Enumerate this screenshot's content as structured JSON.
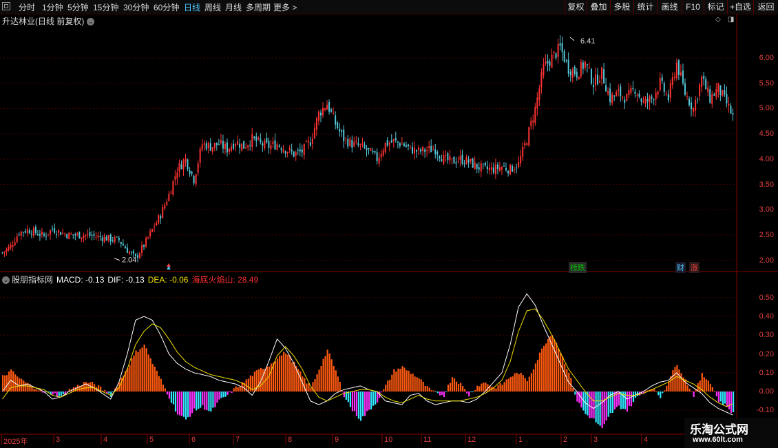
{
  "toolbar": {
    "periods": [
      "分时",
      "1分钟",
      "5分钟",
      "15分钟",
      "30分钟",
      "60分钟",
      "日线",
      "周线",
      "月线",
      "多周期",
      "更多 >"
    ],
    "active_period": "日线",
    "right_buttons": [
      "复权",
      "叠加",
      "多股",
      "统计",
      "画线",
      "F10",
      "标记",
      "+自选",
      "返回"
    ]
  },
  "price_panel": {
    "title": "升达林业(日线 前复权)",
    "high_label": "6.41",
    "low_label": "2.04",
    "axis_ticks": [
      "6.00",
      "5.50",
      "5.00",
      "4.50",
      "4.00",
      "3.50",
      "3.00",
      "2.50",
      "2.00"
    ],
    "tags": [
      {
        "text": "榜跌",
        "color": "#00c000",
        "bg": "#2a2a2a"
      },
      {
        "text": "财",
        "color": "#4fc3f7",
        "bg": "#1a1a2a"
      },
      {
        "text": "涨",
        "color": "#ff4040",
        "bg": "#2a1a1a"
      }
    ]
  },
  "indicator_panel": {
    "name": "股朋指标网",
    "macd_label": "MACD: -0.13",
    "dif_label": "DIF: -0.13",
    "dea_label": "DEA: -0.06",
    "extra_label": "海底火焰山: 28.49",
    "axis_ticks": [
      "0.50",
      "0.40",
      "0.30",
      "0.20",
      "0.10",
      "0.00",
      "-0.10"
    ]
  },
  "date_axis": [
    "2025年",
    "3",
    "4",
    "5",
    "6",
    "7",
    "8",
    "9",
    "10",
    "11",
    "12",
    "1",
    "2",
    "3",
    "4"
  ],
  "watermark": {
    "line1": "乐淘公式网",
    "line2": "www.60lt.com"
  },
  "colors": {
    "up": "#ff3232",
    "down": "#54c8d8",
    "grid": "#4a0000",
    "dif": "#ffffff",
    "dea": "#f0e000",
    "hist_pos": "#ff5a10",
    "hist_neg_a": "#30e8ff",
    "hist_neg_b": "#ff30ff"
  },
  "chart_data": [
    {
      "type": "candlestick",
      "title": "升达林业(日线 前复权)",
      "ylim": [
        1.9,
        6.6
      ],
      "series": [
        {
          "name": "close",
          "values": [
            2.15,
            2.28,
            2.55,
            2.6,
            2.55,
            2.48,
            2.62,
            2.55,
            2.5,
            2.5,
            2.5,
            2.48,
            2.45,
            2.42,
            2.4,
            2.2,
            2.04,
            2.3,
            2.6,
            2.9,
            3.3,
            3.8,
            4.0,
            3.6,
            4.3,
            4.25,
            4.3,
            4.2,
            4.35,
            4.25,
            4.4,
            4.3,
            4.25,
            4.3,
            4.2,
            4.1,
            4.15,
            4.35,
            4.9,
            5.1,
            4.7,
            4.4,
            4.3,
            4.25,
            4.15,
            4.0,
            4.3,
            4.35,
            4.3,
            4.2,
            4.15,
            4.18,
            4.2,
            4.0,
            3.95,
            4.0,
            3.95,
            3.85,
            3.8,
            3.8,
            3.85,
            3.8,
            3.9,
            4.4,
            5.0,
            5.8,
            6.0,
            6.2,
            5.8,
            5.7,
            5.9,
            5.5,
            5.7,
            5.2,
            5.3,
            5.2,
            5.4,
            5.1,
            5.2,
            5.5,
            5.2,
            5.9,
            5.3,
            5.0,
            5.6,
            5.2,
            5.4,
            5.1,
            4.75
          ]
        }
      ]
    },
    {
      "type": "bar",
      "title": "MACD",
      "ylim": [
        -0.22,
        0.58
      ],
      "series": [
        {
          "name": "MACD",
          "values": [
            0.08,
            0.11,
            0.07,
            0.04,
            0.02,
            -0.01,
            -0.01,
            -0.03,
            0.01,
            0.03,
            0.05,
            0.04,
            0.01,
            -0.02,
            0.05,
            0.13,
            0.21,
            0.25,
            0.15,
            0.06,
            -0.03,
            -0.12,
            -0.15,
            -0.1,
            -0.08,
            -0.11,
            -0.05,
            -0.02,
            0.02,
            0.05,
            0.09,
            0.12,
            0.14,
            0.18,
            0.21,
            0.15,
            0.08,
            0.02,
            0.12,
            0.22,
            0.11,
            -0.02,
            -0.1,
            -0.15,
            -0.1,
            -0.05,
            0.03,
            0.11,
            0.13,
            0.1,
            0.07,
            0.02,
            -0.01,
            -0.02,
            0.08,
            0.04,
            -0.02,
            0.03,
            0.05,
            0.02,
            0.04,
            0.08,
            0.1,
            0.06,
            0.15,
            0.25,
            0.31,
            0.21,
            0.1,
            -0.05,
            -0.12,
            -0.15,
            -0.2,
            -0.12,
            -0.08,
            -0.1,
            -0.04,
            0.0,
            0.02,
            -0.03,
            0.06,
            0.15,
            0.06,
            -0.02,
            0.09,
            0.05,
            -0.05,
            -0.08,
            -0.13
          ]
        },
        {
          "name": "DIF",
          "values": [
            0.0,
            0.06,
            0.03,
            0.04,
            0.02,
            0.0,
            -0.04,
            -0.03,
            0.0,
            0.02,
            0.04,
            0.02,
            -0.01,
            -0.04,
            0.05,
            0.2,
            0.38,
            0.4,
            0.38,
            0.3,
            0.2,
            0.15,
            0.12,
            0.1,
            0.09,
            0.08,
            0.06,
            0.05,
            0.04,
            0.02,
            -0.02,
            0.05,
            0.16,
            0.28,
            0.23,
            0.15,
            0.05,
            -0.05,
            -0.07,
            -0.05,
            -0.01,
            0.01,
            0.02,
            0.03,
            0.01,
            0.0,
            -0.05,
            -0.06,
            -0.07,
            -0.02,
            -0.01,
            -0.05,
            -0.07,
            -0.06,
            -0.05,
            -0.05,
            -0.06,
            -0.04,
            0.0,
            0.05,
            0.1,
            0.25,
            0.45,
            0.52,
            0.46,
            0.35,
            0.25,
            0.15,
            0.05,
            0.0,
            -0.06,
            -0.09,
            -0.06,
            -0.02,
            0.0,
            -0.04,
            -0.02,
            0.0,
            0.03,
            0.05,
            0.06,
            0.1,
            0.05,
            0.02,
            -0.01,
            -0.06,
            -0.09,
            -0.11,
            -0.13
          ]
        },
        {
          "name": "DEA",
          "values": [
            -0.04,
            0.02,
            0.03,
            0.03,
            0.02,
            0.01,
            -0.02,
            -0.03,
            -0.01,
            0.01,
            0.02,
            0.02,
            0.0,
            -0.02,
            0.02,
            0.12,
            0.25,
            0.32,
            0.36,
            0.34,
            0.28,
            0.21,
            0.16,
            0.13,
            0.11,
            0.09,
            0.08,
            0.07,
            0.06,
            0.04,
            0.01,
            0.03,
            0.08,
            0.19,
            0.24,
            0.19,
            0.12,
            0.03,
            -0.03,
            -0.05,
            -0.03,
            -0.01,
            0.0,
            0.01,
            0.01,
            0.0,
            -0.03,
            -0.05,
            -0.06,
            -0.04,
            -0.02,
            -0.04,
            -0.05,
            -0.05,
            -0.05,
            -0.05,
            -0.04,
            -0.03,
            -0.01,
            0.02,
            0.06,
            0.16,
            0.32,
            0.43,
            0.44,
            0.38,
            0.3,
            0.21,
            0.12,
            0.06,
            0.0,
            -0.05,
            -0.05,
            -0.03,
            -0.01,
            -0.02,
            -0.02,
            -0.01,
            0.01,
            0.03,
            0.05,
            0.08,
            0.06,
            0.04,
            0.01,
            -0.03,
            -0.06,
            -0.08,
            -0.06
          ]
        }
      ]
    }
  ]
}
